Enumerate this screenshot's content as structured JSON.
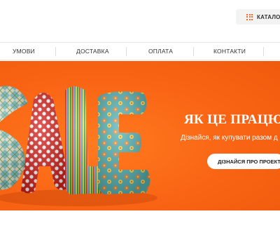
{
  "header": {
    "catalog_label": "КАТАЛОГ",
    "catalog_icon": "grid-icon"
  },
  "nav": {
    "items": [
      "УМОВИ",
      "ДОСТАВКА",
      "ОПЛАТА",
      "КОНТАКТИ"
    ]
  },
  "hero": {
    "title": "ЯК ЦЕ ПРАЦЮЄ",
    "subtitle": "Дізнайся, як купувати разом д",
    "button_label": "ДІЗНАЙСЯ ПРО ПРОЕКТ",
    "background_color": "#f96414",
    "artwork": "SALE inflatable letters"
  }
}
